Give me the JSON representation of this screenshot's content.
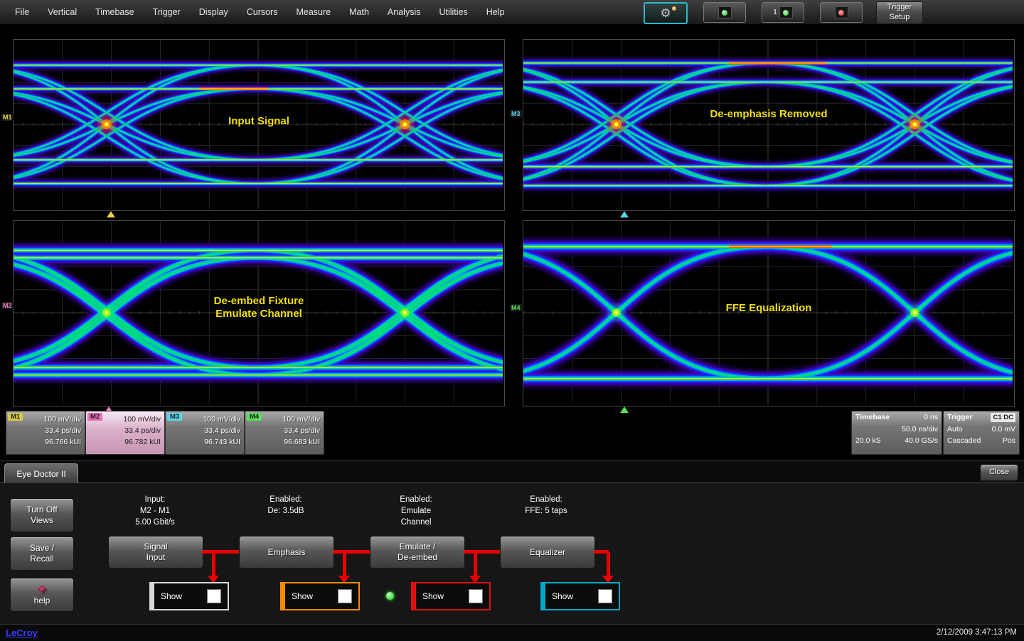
{
  "menu": {
    "items": [
      "File",
      "Vertical",
      "Timebase",
      "Trigger",
      "Display",
      "Cursors",
      "Measure",
      "Math",
      "Analysis",
      "Utilities",
      "Help"
    ]
  },
  "toolbar": {
    "trigger_setup": "Trigger\nSetup",
    "channel_number": "1",
    "icons": {
      "gear": "⚙",
      "help": "◈"
    }
  },
  "panels": [
    {
      "title": "Input Signal",
      "label": "M1",
      "color": "#e8d44a",
      "eye": {
        "crossings": [
          0.19,
          0.8
        ],
        "hw": 0.305,
        "amp": 0.35,
        "levels": [
          1.0,
          0.6
        ],
        "fuzz": 0.8,
        "hot": "red",
        "streak": {
          "level": 1,
          "x0": 0.38,
          "x1": 0.52
        }
      }
    },
    {
      "title": "De-emphasis Removed",
      "label": "M3",
      "color": "#5ad4e8",
      "eye": {
        "crossings": [
          0.19,
          0.8
        ],
        "hw": 0.305,
        "amp": 0.25,
        "levels": [
          1.0,
          1.45
        ],
        "fuzz": 0.85,
        "hot": "red",
        "streak": {
          "level": 1,
          "x0": 0.42,
          "x1": 0.62
        }
      }
    },
    {
      "title": "De-embed Fixture\nEmulate Channel",
      "label": "M2",
      "color": "#f080c8",
      "eye": {
        "crossings": [
          0.19,
          0.8
        ],
        "hw": 0.305,
        "amp": 0.34,
        "levels": [
          1.0,
          0.88
        ],
        "fuzz": 1.3,
        "hot": "green",
        "streak": null
      }
    },
    {
      "title": "FFE Equalization",
      "label": "M4",
      "color": "#5ae05a",
      "eye": {
        "crossings": [
          0.19,
          0.8
        ],
        "hw": 0.305,
        "amp": 0.36,
        "levels": [
          1.0
        ],
        "fuzz": 1.5,
        "hot": "green",
        "streak": {
          "level": 0,
          "x0": 0.42,
          "x1": 0.63
        }
      }
    }
  ],
  "descriptors": [
    {
      "label": "M1",
      "color": "#d8c84a",
      "lines": [
        "100 mV/div",
        "33.4 ps/div",
        "96.766 kUI"
      ]
    },
    {
      "label": "M2",
      "color": "#e86fb4",
      "lines": [
        "100 mV/div",
        "33.4 ps/div",
        "96.782 kUI"
      ]
    },
    {
      "label": "M3",
      "color": "#5ad4e8",
      "lines": [
        "100 mV/div",
        "33.4 ps/div",
        "96.743 kUI"
      ]
    },
    {
      "label": "M4",
      "color": "#5ae05a",
      "lines": [
        "100 mV/div",
        "33.4 ps/div",
        "96.683 kUI"
      ]
    }
  ],
  "timebase": {
    "title": "Timebase",
    "offset": "0 ns",
    "scale": "50.0 ns/div",
    "samples": "20.0 kS",
    "rate": "40.0 GS/s"
  },
  "trigger": {
    "title": "Trigger",
    "source": "C1 DC",
    "mode": "Auto",
    "level": "0.0 mV",
    "type": "Cascaded",
    "slope": "Pos"
  },
  "dialog": {
    "tab": "Eye Doctor II",
    "close": "Close",
    "turn_off": "Turn Off\nViews",
    "save_recall": "Save /\nRecall",
    "help": "help",
    "show_label": "Show",
    "stages": [
      {
        "info": "Input:\nM2 - M1\n5.00 Gbit/s",
        "button": "Signal\nInput",
        "show_color": "#d8d8d8"
      },
      {
        "info": "Enabled:\nDe: 3.5dB",
        "button": "Emphasis",
        "show_color": "#ff8a00"
      },
      {
        "info": "Enabled:\nEmulate\nChannel",
        "button": "Emulate /\nDe-embed",
        "show_color": "#e01010"
      },
      {
        "info": "Enabled:\nFFE: 5 taps",
        "button": "Equalizer",
        "show_color": "#00a8c8"
      }
    ]
  },
  "statusbar": {
    "brand": "LeCroy",
    "datetime": "2/12/2009 3:47:13 PM"
  }
}
